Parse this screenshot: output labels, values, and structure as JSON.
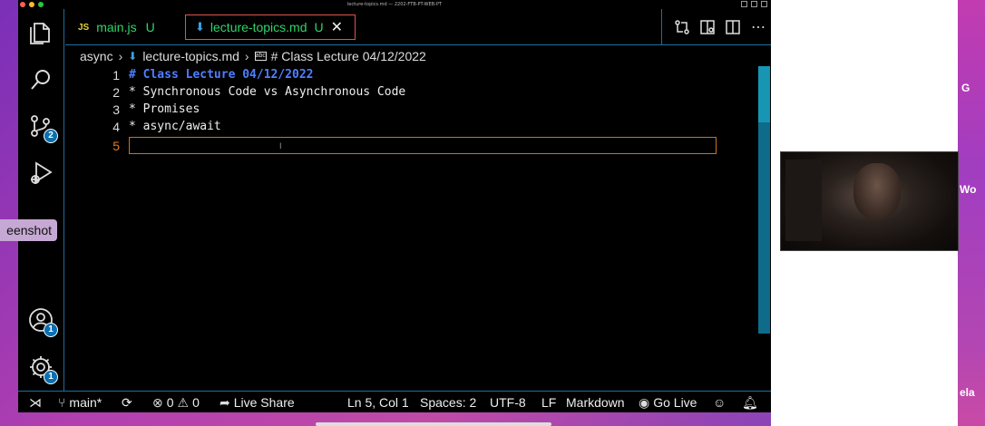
{
  "window": {
    "title": "lecture-topics.md — 2202-FTB-PT-WEB-PT",
    "traffic_colors": [
      "#ff5f57",
      "#febc2e",
      "#28c840"
    ]
  },
  "activity_bar": {
    "items": [
      {
        "name": "explorer-icon"
      },
      {
        "name": "search-icon"
      },
      {
        "name": "source-control-icon",
        "badge": "2"
      },
      {
        "name": "run-debug-icon"
      },
      {
        "name": "account-icon",
        "badge": "1"
      },
      {
        "name": "settings-gear-icon",
        "badge": "1"
      }
    ]
  },
  "tabs": [
    {
      "icon": "JS",
      "label": "main.js",
      "status": "U"
    },
    {
      "icon": "markdown-icon",
      "label": "lecture-topics.md",
      "status": "U",
      "close": "✕"
    }
  ],
  "tab_actions": [
    "compare-changes-icon",
    "open-preview-icon",
    "split-editor-icon",
    "more-actions-icon"
  ],
  "breadcrumb": {
    "folder": "async",
    "file": "lecture-topics.md",
    "symbol": "# Class Lecture 04/12/2022"
  },
  "editor": {
    "lines": [
      {
        "num": "1",
        "text": "# Class Lecture 04/12/2022",
        "heading": true
      },
      {
        "num": "2",
        "text": "* Synchronous Code vs Asynchronous Code",
        "heading": false
      },
      {
        "num": "3",
        "text": "* Promises",
        "heading": false
      },
      {
        "num": "4",
        "text": "* async/await",
        "heading": false
      },
      {
        "num": "5",
        "text": "",
        "heading": false,
        "active": true
      }
    ],
    "cursor_line": "5",
    "accent_heading": "#4f7fff",
    "active_line_color": "#e07a2a"
  },
  "status_bar": {
    "branch": "main*",
    "errors": "0",
    "warnings": "0",
    "live_share": "Live Share",
    "position": "Ln 5, Col 1",
    "spaces": "Spaces: 2",
    "encoding": "UTF-8",
    "eol": "LF",
    "language": "Markdown",
    "go_live": "Go Live"
  },
  "desktop": {
    "screenshot_label": "eenshot",
    "edge_labels": [
      "G",
      "Wo",
      "ela"
    ]
  }
}
